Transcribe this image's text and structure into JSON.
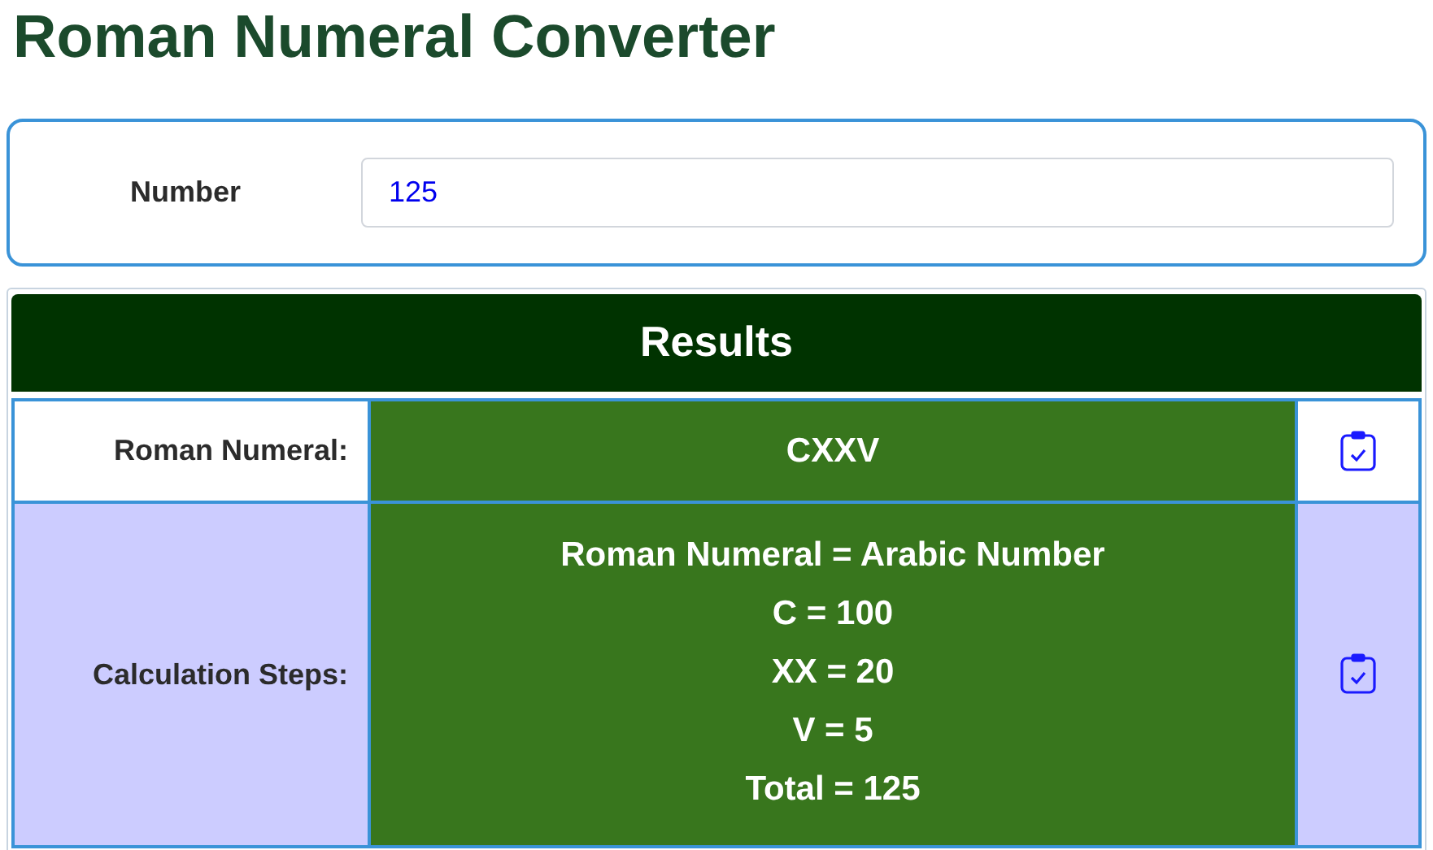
{
  "title": "Roman Numeral Converter",
  "input": {
    "label": "Number",
    "value": "125"
  },
  "results": {
    "heading": "Results",
    "rows": [
      {
        "label": "Roman Numeral:",
        "lines": [
          "CXXV"
        ],
        "shaded": false
      },
      {
        "label": "Calculation Steps:",
        "lines": [
          "Roman Numeral = Arabic Number",
          "C = 100",
          "XX = 20",
          "V = 5",
          "Total = 125"
        ],
        "shaded": true
      }
    ]
  }
}
